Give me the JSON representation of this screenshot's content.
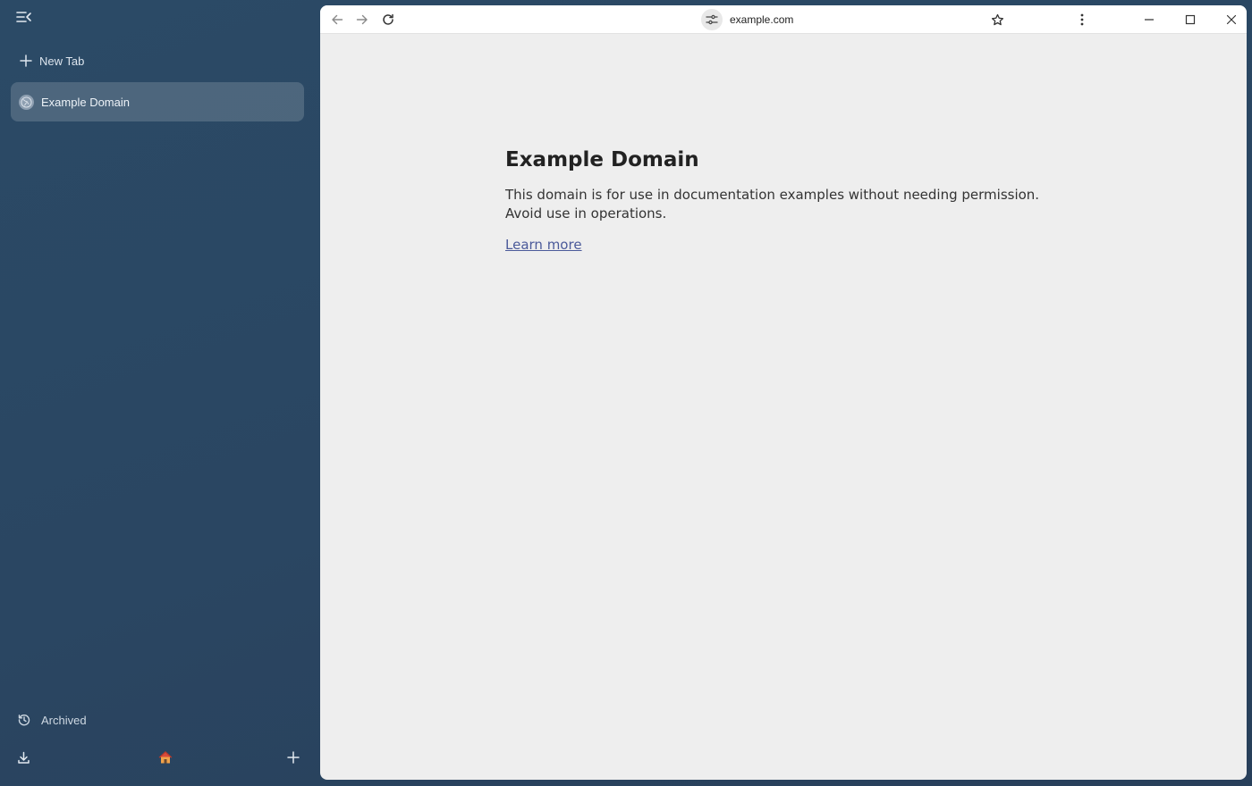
{
  "sidebar": {
    "new_tab_label": "New Tab",
    "tabs": [
      {
        "title": "Example Domain"
      }
    ],
    "archived_label": "Archived"
  },
  "toolbar": {
    "url": "example.com"
  },
  "page": {
    "heading": "Example Domain",
    "body": "This domain is for use in documentation examples without needing permission. Avoid use in operations.",
    "link": "Learn more"
  },
  "colors": {
    "sidebar_bg": "#2a4662",
    "content_bg": "#eeeeee",
    "link": "#4b5a9a"
  }
}
